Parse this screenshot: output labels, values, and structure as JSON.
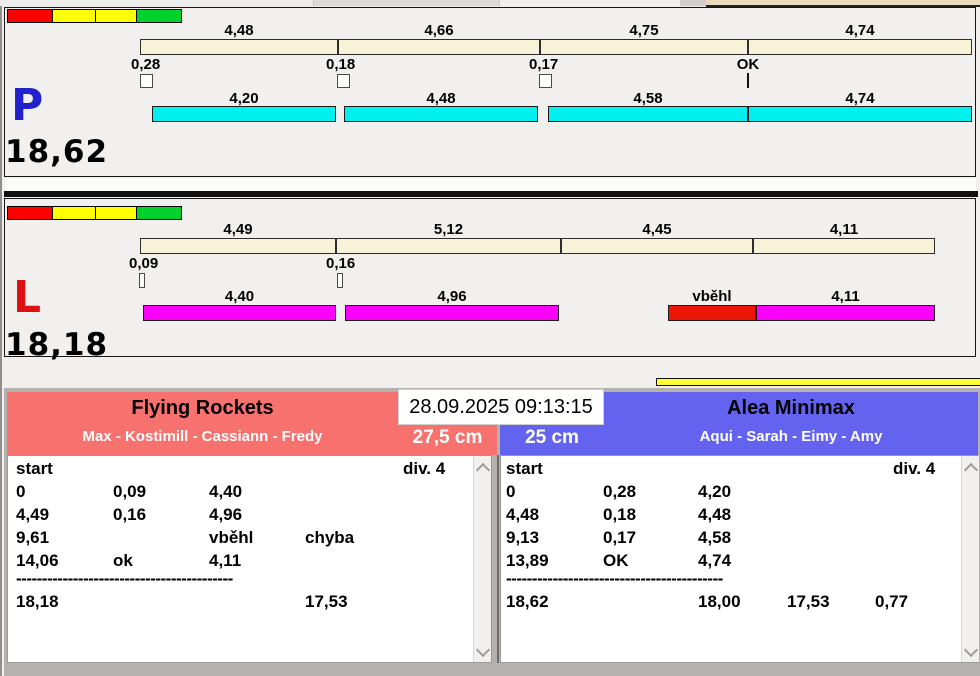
{
  "top": {
    "datetime": "28.09.2025 09:13:15"
  },
  "lanes": {
    "p": {
      "label": "P",
      "total": "18,62",
      "segments": [
        "4,48",
        "4,66",
        "4,75",
        "4,74"
      ],
      "reactions": [
        "0,28",
        "0,18",
        "0,17",
        "OK"
      ],
      "runs": [
        "4,20",
        "4,48",
        "4,58",
        "4,74"
      ]
    },
    "l": {
      "label": "L",
      "total": "18,18",
      "segments": [
        "4,49",
        "5,12",
        "4,45",
        "4,11"
      ],
      "reactions": [
        "0,09",
        "0,16"
      ],
      "runs": [
        "4,40",
        "4,96",
        "vběhl",
        "4,11"
      ]
    }
  },
  "teams": {
    "left": {
      "name": "Flying Rockets",
      "members": "Max - Kostimill - Cassiann - Fredy",
      "hurdle": "27,5 cm",
      "start_label": "start",
      "div_label": "div. 4",
      "rows": [
        [
          "0",
          "0,09",
          "4,40",
          ""
        ],
        [
          "4,49",
          "0,16",
          "4,96",
          ""
        ],
        [
          "9,61",
          "",
          "vběhl",
          "chyba"
        ],
        [
          "14,06",
          "ok",
          "4,11",
          ""
        ]
      ],
      "dash": "------------------------------------------",
      "totals": [
        "18,18",
        "17,53"
      ]
    },
    "right": {
      "name": "Alea Minimax",
      "members": "Aqui - Sarah - Eimy - Amy",
      "hurdle": "25 cm",
      "start_label": "start",
      "div_label": "div. 4",
      "rows": [
        [
          "0",
          "0,28",
          "4,20"
        ],
        [
          "4,48",
          "0,18",
          "4,48"
        ],
        [
          "9,13",
          "0,17",
          "4,58"
        ],
        [
          "13,89",
          "OK",
          "4,74"
        ]
      ],
      "dash": "------------------------------------------",
      "totals": [
        "18,62",
        "18,00",
        "17,53",
        "0,77"
      ]
    }
  },
  "colors": {
    "lane_p_accent": "#2222cc",
    "lane_l_accent": "#dd1111",
    "upper_bar": "#f8f3d8",
    "lane_p_bar": "#00efef",
    "lane_l_bar": "#fb00fb",
    "fault_bar": "#ee1507",
    "team_left_bg": "#f7716e",
    "team_right_bg": "#6363ef",
    "traffic_lights": [
      "#ff0000",
      "#ffff00",
      "#ffff00",
      "#00d22b"
    ]
  }
}
